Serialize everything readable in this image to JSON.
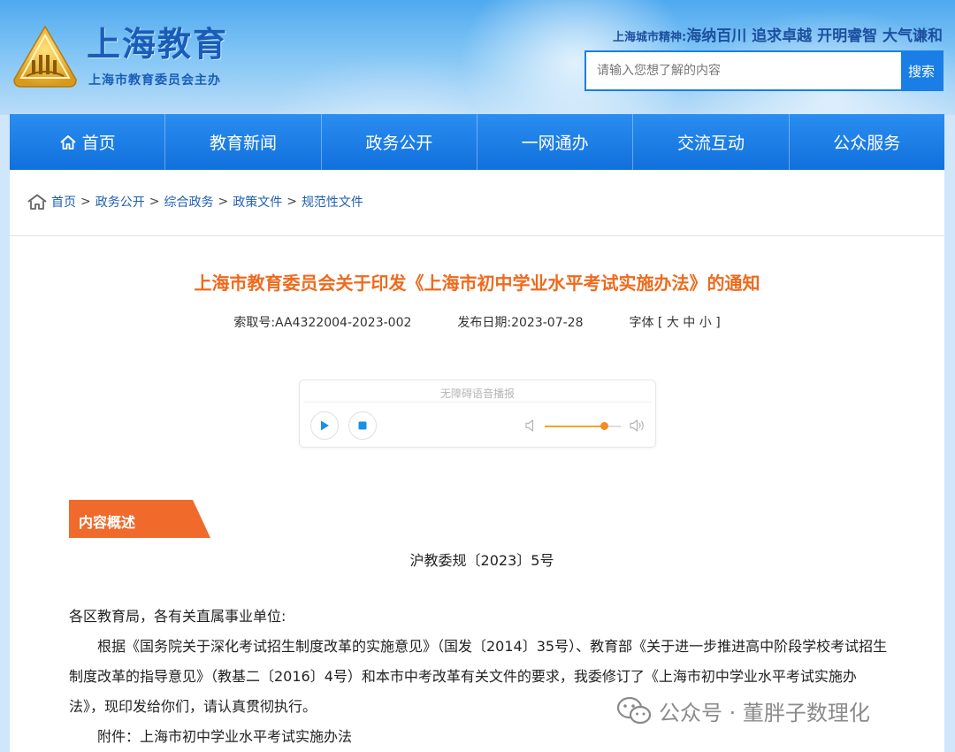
{
  "header": {
    "site_title": "上海教育",
    "site_subtitle": "上海市教育委员会主办",
    "spirit_label": "上海城市精神:",
    "spirit_text": "海纳百川 追求卓越 开明睿智 大气谦和",
    "search_placeholder": "请输入您想了解的内容",
    "search_button": "搜索"
  },
  "nav": {
    "items": [
      {
        "label": "首页"
      },
      {
        "label": "教育新闻"
      },
      {
        "label": "政务公开"
      },
      {
        "label": "一网通办"
      },
      {
        "label": "交流互动"
      },
      {
        "label": "公众服务"
      }
    ]
  },
  "breadcrumb": {
    "items": [
      "首页",
      "政务公开",
      "综合政务",
      "政策文件",
      "规范性文件"
    ],
    "separator": ">"
  },
  "article": {
    "title": "上海市教育委员会关于印发《上海市初中学业水平考试实施办法》的通知",
    "index_no": "索取号:AA4322004-2023-002",
    "publish_date": "发布日期:2023-07-28",
    "font_size_label": "字体 [ 大 中 小 ]",
    "doc_no": "沪教委规〔2023〕5号",
    "salutation": "各区教育局，各有关直属事业单位:",
    "paragraph_1": "根据《国务院关于深化考试招生制度改革的实施意见》（国发〔2014〕35号）、教育部《关于进一步推进高中阶段学校考试招生制度改革的指导意见》（教基二〔2016〕4号）和本市中考改革有关文件的要求，我委修订了《上海市初中学业水平考试实施办法》，现印发给你们，请认真贯彻执行。",
    "attachment": "附件：上海市初中学业水平考试实施办法"
  },
  "player": {
    "label": "无障碍语音播报",
    "volume": 0.78
  },
  "section_tag": "内容概述",
  "watermark": "公众号 · 董胖子数理化",
  "colors": {
    "accent_orange": "#ef6a1d",
    "nav_blue": "#1a7ee6",
    "link_blue": "#1f5fb0"
  }
}
